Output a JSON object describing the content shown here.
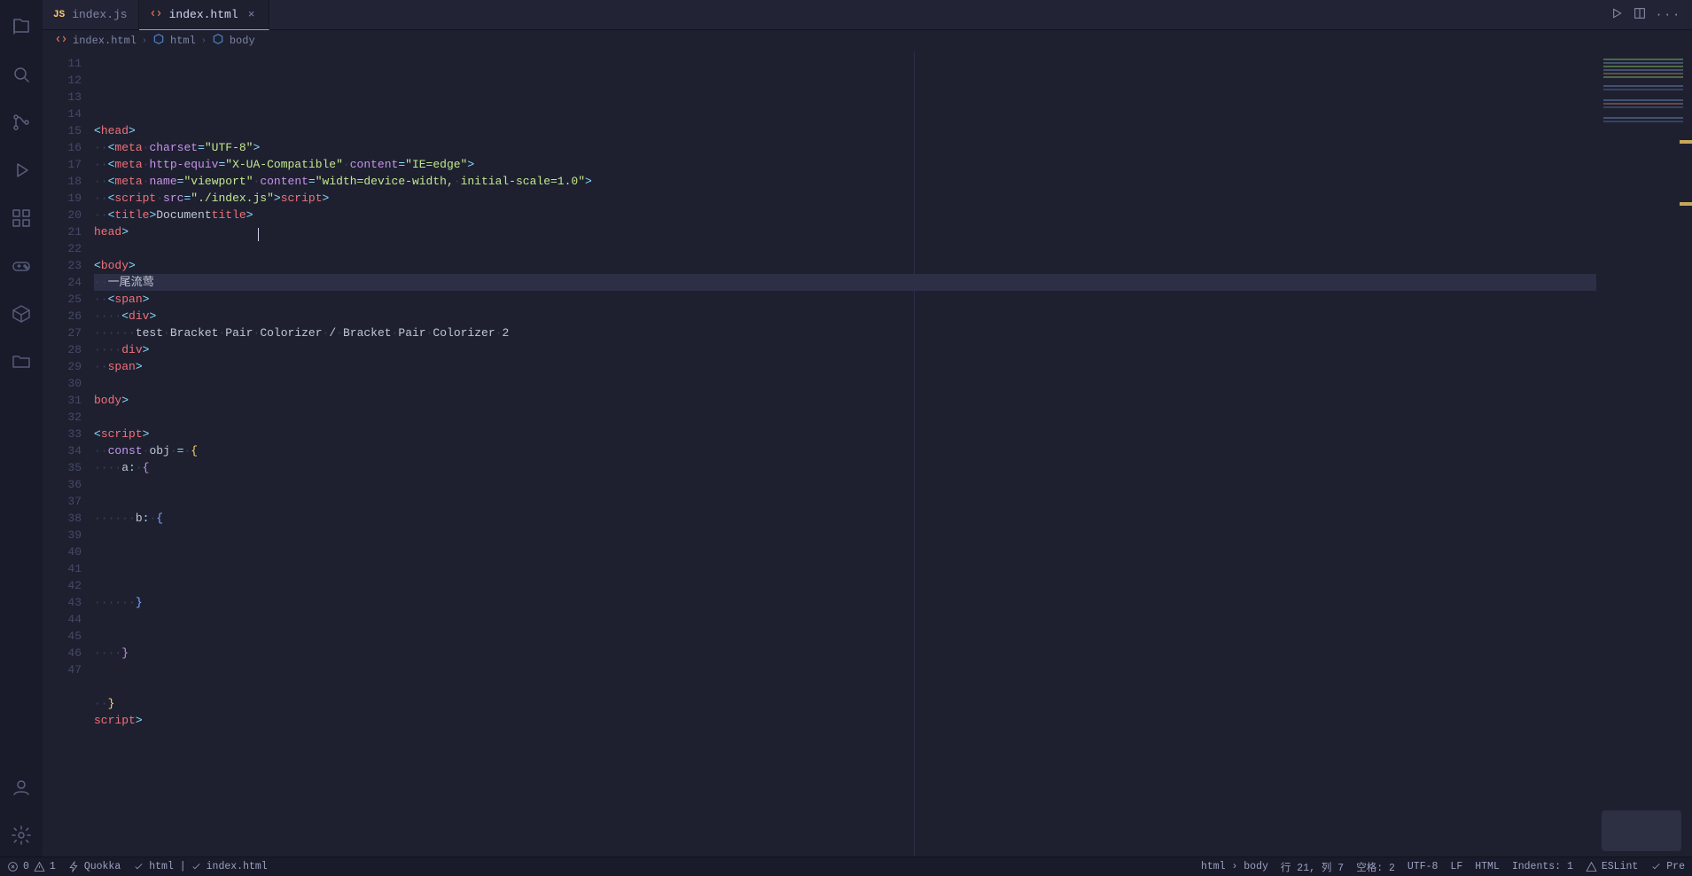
{
  "tabs": [
    {
      "label": "index.js",
      "icon": "js",
      "active": false
    },
    {
      "label": "index.html",
      "icon": "html",
      "active": true
    }
  ],
  "breadcrumb": {
    "file": {
      "label": "index.html",
      "icon": "html"
    },
    "segments": [
      {
        "label": "html",
        "icon": "cube"
      },
      {
        "label": "body",
        "icon": "cube"
      }
    ]
  },
  "lineStart": 11,
  "currentLineIndex": 10,
  "cursor": {
    "textRow": 10,
    "pixelX": 190
  },
  "code": [
    {
      "tokens": []
    },
    {
      "tokens": [
        {
          "t": "pun",
          "v": "<"
        },
        {
          "t": "tag",
          "v": "head"
        },
        {
          "t": "pun",
          "v": ">"
        }
      ]
    },
    {
      "indent": 1,
      "tokens": [
        {
          "t": "pun",
          "v": "<"
        },
        {
          "t": "tag",
          "v": "meta"
        },
        {
          "t": "plain",
          "v": " "
        },
        {
          "t": "attr",
          "v": "charset"
        },
        {
          "t": "pun",
          "v": "="
        },
        {
          "t": "str",
          "v": "\"UTF-8\""
        },
        {
          "t": "pun",
          "v": ">"
        }
      ]
    },
    {
      "indent": 1,
      "tokens": [
        {
          "t": "pun",
          "v": "<"
        },
        {
          "t": "tag",
          "v": "meta"
        },
        {
          "t": "plain",
          "v": " "
        },
        {
          "t": "attr",
          "v": "http-equiv"
        },
        {
          "t": "pun",
          "v": "="
        },
        {
          "t": "str",
          "v": "\"X-UA-Compatible\""
        },
        {
          "t": "plain",
          "v": " "
        },
        {
          "t": "attr",
          "v": "content"
        },
        {
          "t": "pun",
          "v": "="
        },
        {
          "t": "str",
          "v": "\"IE=edge\""
        },
        {
          "t": "pun",
          "v": ">"
        }
      ]
    },
    {
      "indent": 1,
      "tokens": [
        {
          "t": "pun",
          "v": "<"
        },
        {
          "t": "tag",
          "v": "meta"
        },
        {
          "t": "plain",
          "v": " "
        },
        {
          "t": "attr",
          "v": "name"
        },
        {
          "t": "pun",
          "v": "="
        },
        {
          "t": "str",
          "v": "\"viewport\""
        },
        {
          "t": "plain",
          "v": " "
        },
        {
          "t": "attr",
          "v": "content"
        },
        {
          "t": "pun",
          "v": "="
        },
        {
          "t": "str",
          "v": "\"width=device-width, initial-scale=1.0\""
        },
        {
          "t": "pun",
          "v": ">"
        }
      ]
    },
    {
      "indent": 1,
      "tokens": [
        {
          "t": "pun",
          "v": "<"
        },
        {
          "t": "tag",
          "v": "script"
        },
        {
          "t": "plain",
          "v": " "
        },
        {
          "t": "attr",
          "v": "src"
        },
        {
          "t": "pun",
          "v": "="
        },
        {
          "t": "str",
          "v": "\"./index.js\""
        },
        {
          "t": "pun",
          "v": ">"
        },
        {
          "t": "pun",
          "v": "</"
        },
        {
          "t": "tag",
          "v": "script"
        },
        {
          "t": "pun",
          "v": ">"
        }
      ]
    },
    {
      "indent": 1,
      "tokens": [
        {
          "t": "pun",
          "v": "<"
        },
        {
          "t": "tag",
          "v": "title"
        },
        {
          "t": "pun",
          "v": ">"
        },
        {
          "t": "plain",
          "v": "Document"
        },
        {
          "t": "pun",
          "v": "</"
        },
        {
          "t": "tag",
          "v": "title"
        },
        {
          "t": "pun",
          "v": ">"
        }
      ]
    },
    {
      "tokens": [
        {
          "t": "pun",
          "v": "</"
        },
        {
          "t": "tag",
          "v": "head"
        },
        {
          "t": "pun",
          "v": ">"
        }
      ]
    },
    {
      "tokens": []
    },
    {
      "tokens": [
        {
          "t": "pun",
          "v": "<"
        },
        {
          "t": "tag",
          "v": "body"
        },
        {
          "t": "pun",
          "v": ">"
        }
      ]
    },
    {
      "indent": 1,
      "current": true,
      "tokens": [
        {
          "t": "plain",
          "v": "一尾流莺"
        }
      ]
    },
    {
      "indent": 1,
      "tokens": [
        {
          "t": "pun",
          "v": "<"
        },
        {
          "t": "tag",
          "v": "span"
        },
        {
          "t": "pun",
          "v": ">"
        }
      ]
    },
    {
      "indent": 2,
      "tokens": [
        {
          "t": "pun",
          "v": "<"
        },
        {
          "t": "tag",
          "v": "div"
        },
        {
          "t": "pun",
          "v": ">"
        }
      ]
    },
    {
      "indent": 3,
      "tokens": [
        {
          "t": "plain",
          "v": "test Bracket Pair Colorizer / Bracket Pair Colorizer 2"
        }
      ]
    },
    {
      "indent": 2,
      "tokens": [
        {
          "t": "pun",
          "v": "</"
        },
        {
          "t": "tag",
          "v": "div"
        },
        {
          "t": "pun",
          "v": ">"
        }
      ]
    },
    {
      "indent": 1,
      "tokens": [
        {
          "t": "pun",
          "v": "</"
        },
        {
          "t": "tag",
          "v": "span"
        },
        {
          "t": "pun",
          "v": ">"
        }
      ]
    },
    {
      "tokens": []
    },
    {
      "tokens": [
        {
          "t": "pun",
          "v": "</"
        },
        {
          "t": "tag",
          "v": "body"
        },
        {
          "t": "pun",
          "v": ">"
        }
      ]
    },
    {
      "tokens": []
    },
    {
      "tokens": [
        {
          "t": "pun",
          "v": "<"
        },
        {
          "t": "tag",
          "v": "script"
        },
        {
          "t": "pun",
          "v": ">"
        }
      ]
    },
    {
      "indent": 1,
      "tokens": [
        {
          "t": "kw",
          "v": "const"
        },
        {
          "t": "plain",
          "v": " "
        },
        {
          "t": "plain",
          "v": "obj"
        },
        {
          "t": "plain",
          "v": " "
        },
        {
          "t": "pun",
          "v": "="
        },
        {
          "t": "plain",
          "v": " "
        },
        {
          "t": "yellow",
          "v": "{"
        }
      ]
    },
    {
      "indent": 2,
      "tokens": [
        {
          "t": "plain",
          "v": "a"
        },
        {
          "t": "pun",
          "v": ":"
        },
        {
          "t": "plain",
          "v": " "
        },
        {
          "t": "lilac",
          "v": "{"
        }
      ]
    },
    {
      "tokens": []
    },
    {
      "tokens": []
    },
    {
      "indent": 3,
      "tokens": [
        {
          "t": "plain",
          "v": "b"
        },
        {
          "t": "pun",
          "v": ":"
        },
        {
          "t": "plain",
          "v": " "
        },
        {
          "t": "blue",
          "v": "{"
        }
      ]
    },
    {
      "tokens": []
    },
    {
      "tokens": []
    },
    {
      "tokens": []
    },
    {
      "tokens": []
    },
    {
      "indent": 3,
      "tokens": [
        {
          "t": "blue",
          "v": "}"
        }
      ]
    },
    {
      "tokens": []
    },
    {
      "tokens": []
    },
    {
      "indent": 2,
      "tokens": [
        {
          "t": "lilac",
          "v": "}"
        }
      ]
    },
    {
      "tokens": []
    },
    {
      "tokens": []
    },
    {
      "indent": 1,
      "tokens": [
        {
          "t": "yellow",
          "v": "}"
        }
      ]
    },
    {
      "tokens": [
        {
          "t": "pun",
          "v": "</"
        },
        {
          "t": "tag",
          "v": "script"
        },
        {
          "t": "pun",
          "v": ">"
        }
      ]
    }
  ],
  "statusbar": {
    "left": [
      {
        "key": "errors_warnings",
        "icon": "xcircle",
        "label": "0",
        "icon2": "warn",
        "label2": "1"
      },
      {
        "key": "quokka",
        "icon": "bolt",
        "label": "Quokka"
      },
      {
        "key": "prettier_file",
        "icon": "check",
        "label": "html | "
      },
      {
        "key": "prettier_file2",
        "icon": "check",
        "label": "index.html"
      }
    ],
    "right": [
      {
        "key": "selector",
        "label": "html › body"
      },
      {
        "key": "lncol",
        "label": "行 21, 列 7"
      },
      {
        "key": "spaces",
        "label": "空格: 2"
      },
      {
        "key": "encoding",
        "label": "UTF-8"
      },
      {
        "key": "eol",
        "label": "LF"
      },
      {
        "key": "lang",
        "label": "HTML"
      },
      {
        "key": "indents",
        "label": "Indents: 1"
      },
      {
        "key": "eslint",
        "icon": "warn",
        "label": "ESLint"
      },
      {
        "key": "prettier",
        "icon": "check",
        "label": "Pre"
      }
    ]
  }
}
